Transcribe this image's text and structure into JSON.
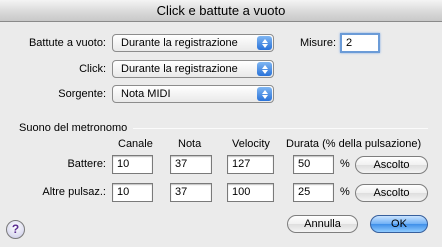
{
  "window": {
    "title": "Click e battute a vuoto"
  },
  "battute": {
    "label": "Battute a vuoto:",
    "value": "Durante la registrazione"
  },
  "misure": {
    "label": "Misure:",
    "value": "2"
  },
  "click": {
    "label": "Click:",
    "value": "Durante la registrazione"
  },
  "sorgente": {
    "label": "Sorgente:",
    "value": "Nota MIDI"
  },
  "metronome": {
    "group_label": "Suono del metronomo",
    "columns": {
      "canale": "Canale",
      "nota": "Nota",
      "velocity": "Velocity",
      "durata": "Durata (% della pulsazione)"
    },
    "percent_sign": "%",
    "rows": [
      {
        "label": "Battere:",
        "canale": "10",
        "nota": "37",
        "velocity": "127",
        "durata": "50",
        "button": "Ascolto"
      },
      {
        "label": "Altre pulsaz.:",
        "canale": "10",
        "nota": "37",
        "velocity": "100",
        "durata": "25",
        "button": "Ascolto"
      }
    ]
  },
  "buttons": {
    "help": "?",
    "cancel": "Annulla",
    "ok": "OK"
  }
}
